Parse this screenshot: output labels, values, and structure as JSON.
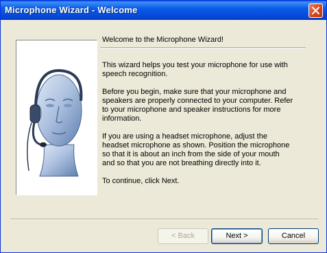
{
  "window": {
    "title": "Microphone Wizard - Welcome"
  },
  "content": {
    "heading": "Welcome to the Microphone Wizard!",
    "paragraphs": [
      "This wizard helps you test your microphone for use with\nspeech recognition.",
      "Before you begin, make sure that your microphone and\nspeakers are properly connected to your computer. Refer\nto your microphone and speaker instructions for more\ninformation.",
      "If you are using a headset microphone, adjust the\nheadset microphone as shown. Position the microphone\nso that it is about an inch from the side of your mouth\nand so that you are not breathing directly into it.",
      "To continue, click Next."
    ]
  },
  "buttons": {
    "back": "< Back",
    "next": "Next >",
    "cancel": "Cancel"
  },
  "icons": {
    "close": "close-icon",
    "illustration": "headset-head-illustration"
  },
  "colors": {
    "titlebar": "#0a5ce6",
    "close": "#d8451f",
    "dialog": "#ece9d8"
  }
}
